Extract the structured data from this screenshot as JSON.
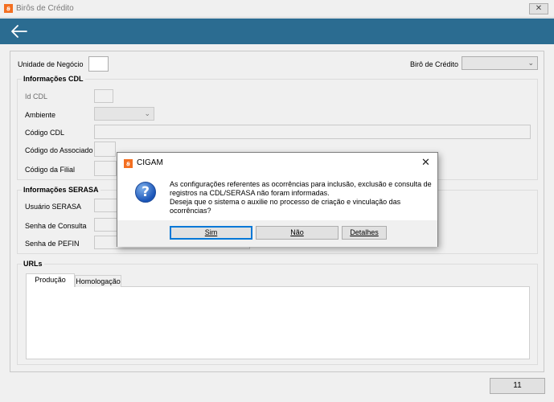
{
  "window": {
    "title": "Birôs de Crédito",
    "app_icon": "cigam-logo-icon",
    "close_glyph": "✕"
  },
  "header": {
    "back_icon": "arrow-left-icon",
    "accent_color": "#2b6c91"
  },
  "form": {
    "unidade_label": "Unidade de Negócio",
    "unidade_value": "",
    "biro_label": "Birô de Crédito",
    "biro_value": "",
    "cdl": {
      "title": "Informações CDL",
      "id_label": "Id CDL",
      "ambiente_label": "Ambiente",
      "codigo_cdl_label": "Código CDL",
      "associado_label": "Código do Associado",
      "filial_label": "Código da Filial"
    },
    "serasa": {
      "title": "Informações SERASA",
      "usuario_label": "Usuário SERASA",
      "senha_consulta_label": "Senha de Consulta",
      "senha_pefin_label": "Senha de PEFIN"
    },
    "urls": {
      "title": "URLs",
      "tabs": [
        "Produção",
        "Homologação"
      ],
      "active_tab": "Produção"
    }
  },
  "footer": {
    "button_label": "11"
  },
  "dialog": {
    "title": "CIGAM",
    "icon": "question-icon",
    "message_lines": [
      "As configurações referentes as ocorrências para inclusão, exclusão e consulta de",
      "registros na CDL/SERASA não foram informadas.",
      "Deseja que o sistema o auxilie no processo de criação e vinculação das",
      "ocorrências?"
    ],
    "buttons": {
      "yes": "Sim",
      "no": "Não",
      "details": "Detalhes"
    }
  }
}
